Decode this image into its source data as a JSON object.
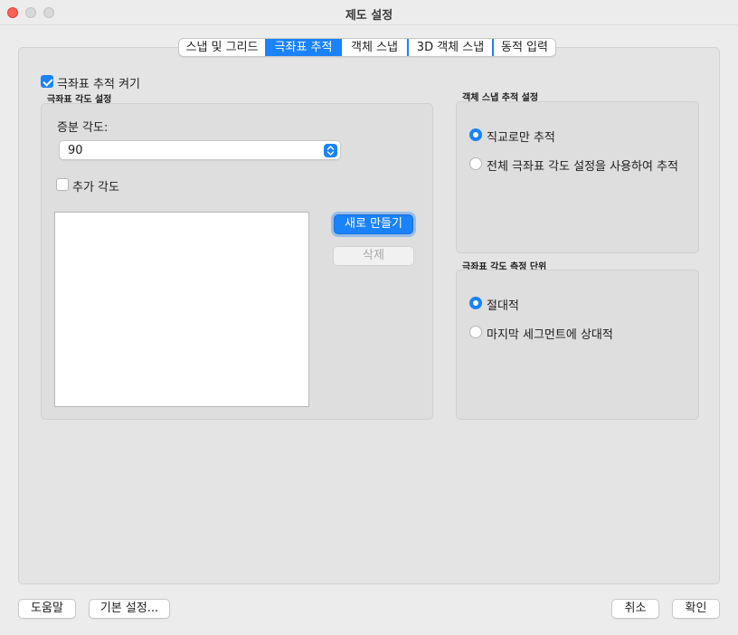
{
  "window": {
    "title": "제도 설정"
  },
  "tabs": [
    {
      "label": "스냅 및 그리드",
      "active": false
    },
    {
      "label": "극좌표 추적",
      "active": true
    },
    {
      "label": "객체 스냅",
      "active": false
    },
    {
      "label": "3D 객체 스냅",
      "active": false
    },
    {
      "label": "동적 입력",
      "active": false
    }
  ],
  "polar": {
    "enable_label": "극좌표 추적 켜기",
    "enabled": true,
    "angle_group_title": "극좌표 각도 설정",
    "increment_label": "증분 각도:",
    "increment_value": "90",
    "additional_label": "추가 각도",
    "additional_checked": false,
    "new_button": "새로 만들기",
    "delete_button": "삭제"
  },
  "osnap_tracking": {
    "title": "객체 스냅 추적 설정",
    "options": [
      {
        "label": "직교로만 추적",
        "selected": true
      },
      {
        "label": "전체 극좌표 각도 설정을 사용하여 추적",
        "selected": false
      }
    ]
  },
  "angle_measurement": {
    "title": "극좌표 각도 측정 단위",
    "options": [
      {
        "label": "절대적",
        "selected": true
      },
      {
        "label": "마지막 세그먼트에 상대적",
        "selected": false
      }
    ]
  },
  "footer": {
    "help": "도움말",
    "defaults": "기본 설정...",
    "cancel": "취소",
    "ok": "확인"
  },
  "colors": {
    "accent": "#1a82fb",
    "close": "#fe5f57"
  }
}
